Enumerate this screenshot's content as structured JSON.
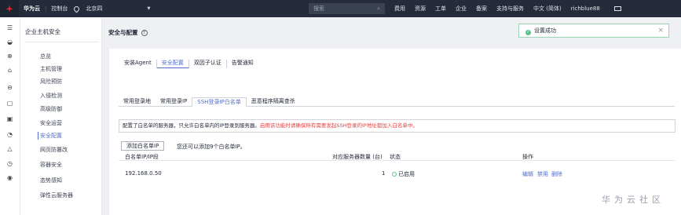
{
  "topbar": {
    "brand": "华为云",
    "console": "控制台",
    "region": "北京四",
    "search_placeholder": "搜索",
    "nav": [
      "费用",
      "资源",
      "工单",
      "企业",
      "备案",
      "支持与服务",
      "中文 (简体)",
      "richblue88"
    ]
  },
  "sidebar": {
    "title": "企业主机安全",
    "items": [
      {
        "label": "总览"
      },
      {
        "label": "主机管理"
      },
      {
        "label": "风险预防"
      },
      {
        "label": "入侵检测"
      },
      {
        "label": "高级防御"
      },
      {
        "label": "安全运营"
      },
      {
        "label": "安全配置"
      },
      {
        "label": "网页防篡改"
      },
      {
        "label": "容器安全"
      },
      {
        "label": "态势感知"
      },
      {
        "label": "弹性云服务器"
      }
    ]
  },
  "page": {
    "title": "安全与配置",
    "tabs": [
      "安装Agent",
      "安全配置",
      "双因子认证",
      "告警通知"
    ],
    "subtabs": [
      "常用登录地",
      "常用登录IP",
      "SSH登录IP白名单",
      "恶意程序隔离查杀"
    ],
    "notice_main": "配置了白名单的服务器，只允许白名单内的IP登录到服务器。",
    "notice_warn": "启用该功能时请确保所有需要发起SSH登录的IP地址都加入白名单中。",
    "add_button": "添加白名单IP",
    "add_hint": "您还可以添加9个白名单IP。",
    "table": {
      "headers": [
        "白名单IP/IP段",
        "对应服务器数量 (台)",
        "状态",
        "操作"
      ],
      "rows": [
        {
          "ip": "192.168.0.50",
          "count": "1",
          "status": "已启用",
          "actions": [
            "编辑",
            "禁用",
            "删除"
          ]
        }
      ]
    }
  },
  "toast": {
    "text": "设置成功"
  },
  "watermark": "华为云社区",
  "colors": {
    "accent": "#526ecc",
    "warning": "#e84141",
    "success": "#5ac48a",
    "topbar": "#252b3a"
  }
}
